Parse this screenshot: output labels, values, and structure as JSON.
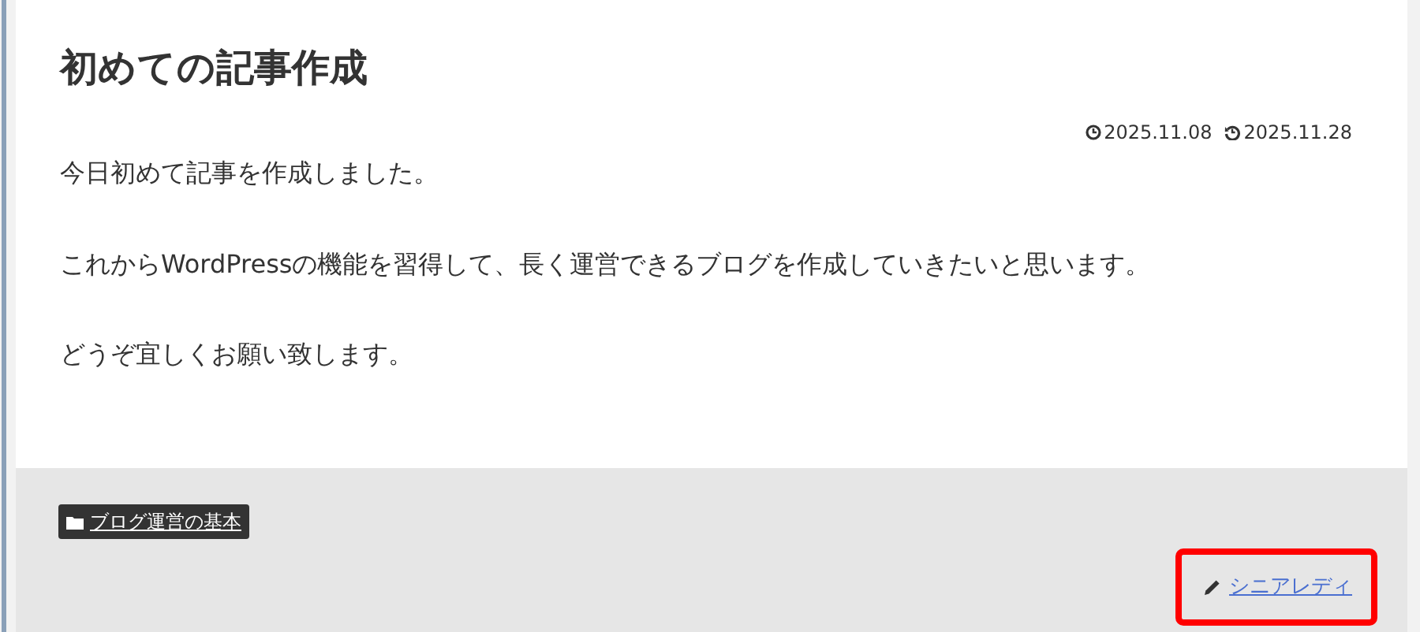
{
  "article": {
    "title": "初めての記事作成",
    "dates": [
      {
        "kind": "published",
        "text": "2025.11.08"
      },
      {
        "kind": "updated",
        "text": "2025.11.28"
      }
    ],
    "paragraphs": [
      "今日初めて記事を作成しました。",
      "これからWordPressの機能を習得して、長く運営できるブログを作成していきたいと思います。",
      "どうぞ宜しくお願い致します。"
    ]
  },
  "footer": {
    "category": {
      "label": "ブログ運営の基本"
    },
    "author": {
      "name": "シニアレディ",
      "highlighted": true
    }
  }
}
